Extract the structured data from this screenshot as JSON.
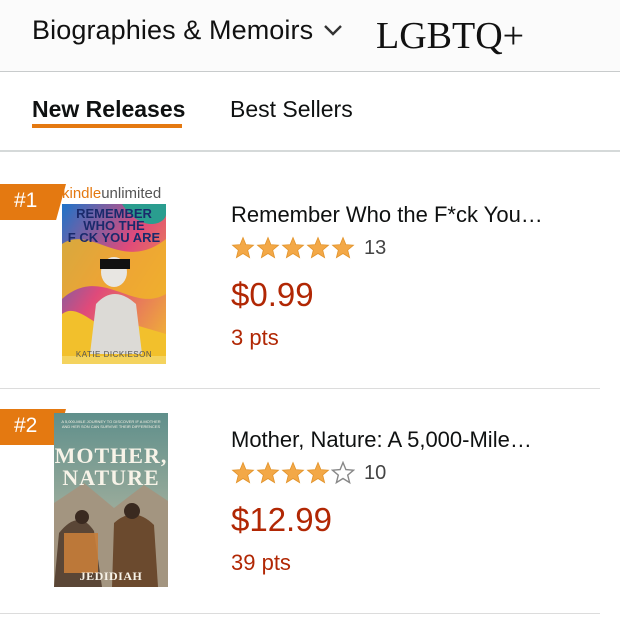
{
  "header": {
    "category": "Biographies & Memoirs",
    "overlay_tag": "LGBTQ+"
  },
  "tabs": [
    {
      "label": "New Releases",
      "active": true
    },
    {
      "label": "Best Sellers",
      "active": false
    }
  ],
  "items": [
    {
      "rank": "#1",
      "badge": {
        "brand_a": "kindle",
        "brand_b": "unlimited"
      },
      "cover": {
        "title_lines": [
          "REMEMBER",
          "WHO THE",
          "F CK YOU ARE"
        ],
        "author": "KATIE DICKIESON"
      },
      "title": "Remember Who the F*ck You…",
      "rating_stars": 5,
      "rating_count": "13",
      "price": "$0.99",
      "points": "3 pts"
    },
    {
      "rank": "#2",
      "cover": {
        "subtitle": "A 5,000-MILE JOURNEY TO DISCOVER IF A MOTHER AND HER SON CAN SURVIVE THEIR DIFFERENCES",
        "title_lines": [
          "MOTHER,",
          "NATURE"
        ],
        "author": "JEDIDIAH JENKINS"
      },
      "title": "Mother, Nature: A 5,000-Mile…",
      "rating_stars": 4,
      "rating_count": "10",
      "price": "$12.99",
      "points": "39 pts"
    }
  ],
  "colors": {
    "accent": "#e47911",
    "price": "#b12704",
    "star": "#f3a847"
  }
}
